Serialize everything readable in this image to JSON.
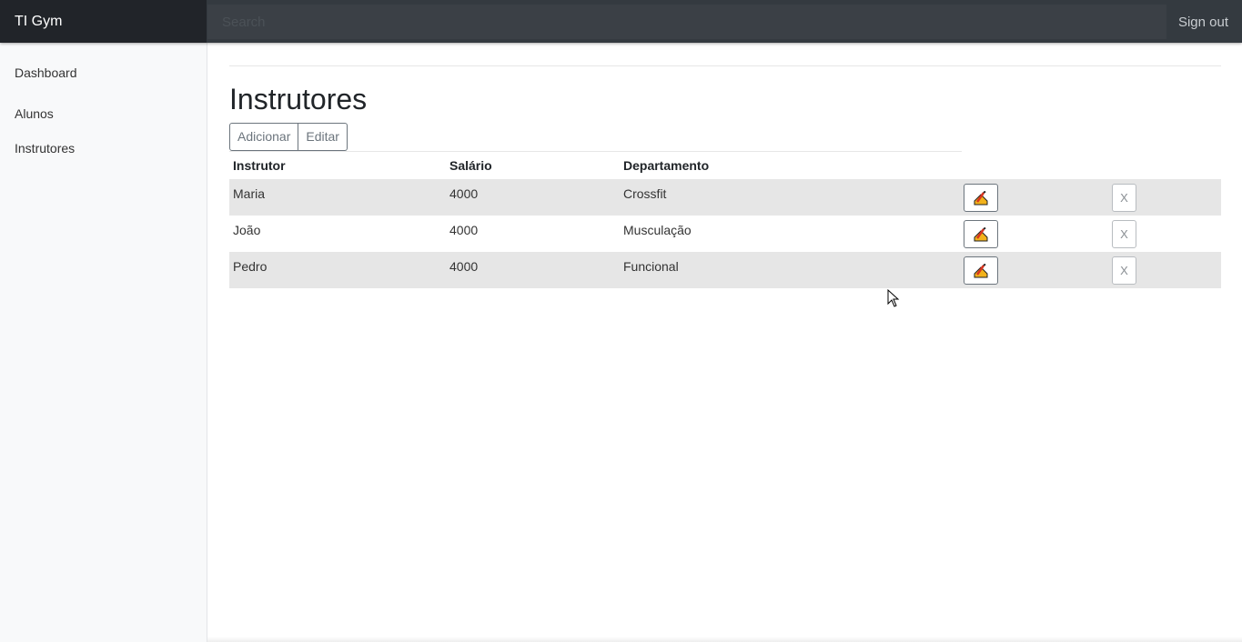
{
  "navbar": {
    "brand": "TI Gym",
    "search_placeholder": "Search",
    "signout_label": "Sign out"
  },
  "sidebar": {
    "items": [
      {
        "label": "Dashboard"
      },
      {
        "label": "Alunos"
      },
      {
        "label": "Instrutores"
      }
    ]
  },
  "main": {
    "title": "Instrutores",
    "buttons": {
      "add_label": "Adicionar",
      "edit_label": "Editar"
    },
    "table": {
      "headers": [
        "Instrutor",
        "Salário",
        "Departamento"
      ],
      "rows": [
        {
          "instrutor": "Maria",
          "salario": "4000",
          "departamento": "Crossfit",
          "delete_label": "X"
        },
        {
          "instrutor": "João",
          "salario": "4000",
          "departamento": "Musculação",
          "delete_label": "X"
        },
        {
          "instrutor": "Pedro",
          "salario": "4000",
          "departamento": "Funcional",
          "delete_label": "X"
        }
      ],
      "edit_icon": "pencil-edit-icon"
    }
  },
  "colors": {
    "navbar": "#343a40",
    "brand_bg": "#212429",
    "sidebar_bg": "#f8f9fa",
    "row_stripe": "#e6e6e6",
    "secondary": "#6c757d"
  }
}
